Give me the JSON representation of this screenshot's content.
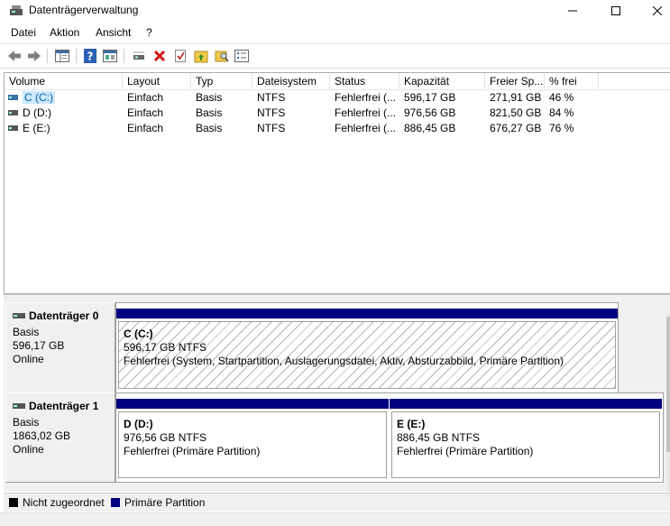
{
  "window": {
    "title": "Datenträgerverwaltung"
  },
  "menu": {
    "items": [
      "Datei",
      "Aktion",
      "Ansicht",
      "?"
    ]
  },
  "toolbar": {
    "icons": [
      "back-icon",
      "forward-icon",
      "console-tree-icon",
      "help-icon",
      "properties-icon",
      "connect-disk-icon",
      "delete-icon",
      "check-icon",
      "folder-up-icon",
      "search-folder-icon",
      "settings-list-icon"
    ]
  },
  "volume_list": {
    "columns": [
      "Volume",
      "Layout",
      "Typ",
      "Dateisystem",
      "Status",
      "Kapazität",
      "Freier Sp...",
      "% frei"
    ],
    "rows": [
      {
        "volume": "C (C:)",
        "layout": "Einfach",
        "typ": "Basis",
        "dateisystem": "NTFS",
        "status": "Fehlerfrei (...",
        "kapazitaet": "596,17 GB",
        "frei": "271,91 GB",
        "prozent": "46 %"
      },
      {
        "volume": "D (D:)",
        "layout": "Einfach",
        "typ": "Basis",
        "dateisystem": "NTFS",
        "status": "Fehlerfrei (...",
        "kapazitaet": "976,56 GB",
        "frei": "821,50 GB",
        "prozent": "84 %"
      },
      {
        "volume": "E (E:)",
        "layout": "Einfach",
        "typ": "Basis",
        "dateisystem": "NTFS",
        "status": "Fehlerfrei (...",
        "kapazitaet": "886,45 GB",
        "frei": "676,27 GB",
        "prozent": "76 %"
      }
    ]
  },
  "disks": [
    {
      "name": "Datenträger 0",
      "type": "Basis",
      "size": "596,17 GB",
      "state": "Online",
      "partitions": [
        {
          "name": "C  (C:)",
          "size": "596,17 GB NTFS",
          "status": "Fehlerfrei (System, Startpartition, Auslagerungsdatei, Aktiv, Absturzabbild, Primäre Partition)"
        }
      ]
    },
    {
      "name": "Datenträger 1",
      "type": "Basis",
      "size": "1863,02 GB",
      "state": "Online",
      "partitions": [
        {
          "name": "D  (D:)",
          "size": "976,56 GB NTFS",
          "status": "Fehlerfrei (Primäre Partition)"
        },
        {
          "name": "E  (E:)",
          "size": "886,45 GB NTFS",
          "status": "Fehlerfrei (Primäre Partition)"
        }
      ]
    }
  ],
  "legend": {
    "items": [
      {
        "label": "Nicht zugeordnet",
        "color": "#000000"
      },
      {
        "label": "Primäre Partition",
        "color": "#000080"
      }
    ]
  },
  "colors": {
    "partition_bar": "#000080",
    "selection": "#cce8ff"
  }
}
